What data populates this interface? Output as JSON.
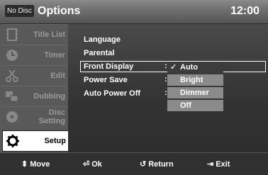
{
  "header": {
    "no_disc": "No Disc",
    "title": "Options",
    "time": "12:00"
  },
  "sidebar": {
    "items": [
      {
        "label": "Title List",
        "icon": "film-icon"
      },
      {
        "label": "Timer",
        "icon": "clock-icon"
      },
      {
        "label": "Edit",
        "icon": "scissors-icon"
      },
      {
        "label": "Dubbing",
        "icon": "dubbing-icon"
      },
      {
        "label": "Disc",
        "label2": "Setting",
        "icon": "disc-icon"
      },
      {
        "label": "Setup",
        "icon": "gear-icon",
        "active": true
      }
    ]
  },
  "menu": {
    "items": [
      "Language",
      "Parental",
      "Front Display",
      "Power Save",
      "Auto Power Off"
    ],
    "colon": ":",
    "selected_index": 2
  },
  "dropdown": {
    "check": "✓",
    "options": [
      "Auto",
      "Bright",
      "Dimmer",
      "Off"
    ],
    "selected_index": 0
  },
  "footer": {
    "move": {
      "glyph": "⬍",
      "label": "Move"
    },
    "ok": {
      "glyph": "⏎",
      "label": "Ok"
    },
    "return": {
      "glyph": "↺",
      "label": "Return"
    },
    "exit": {
      "glyph": "⇥",
      "label": "Exit"
    }
  }
}
